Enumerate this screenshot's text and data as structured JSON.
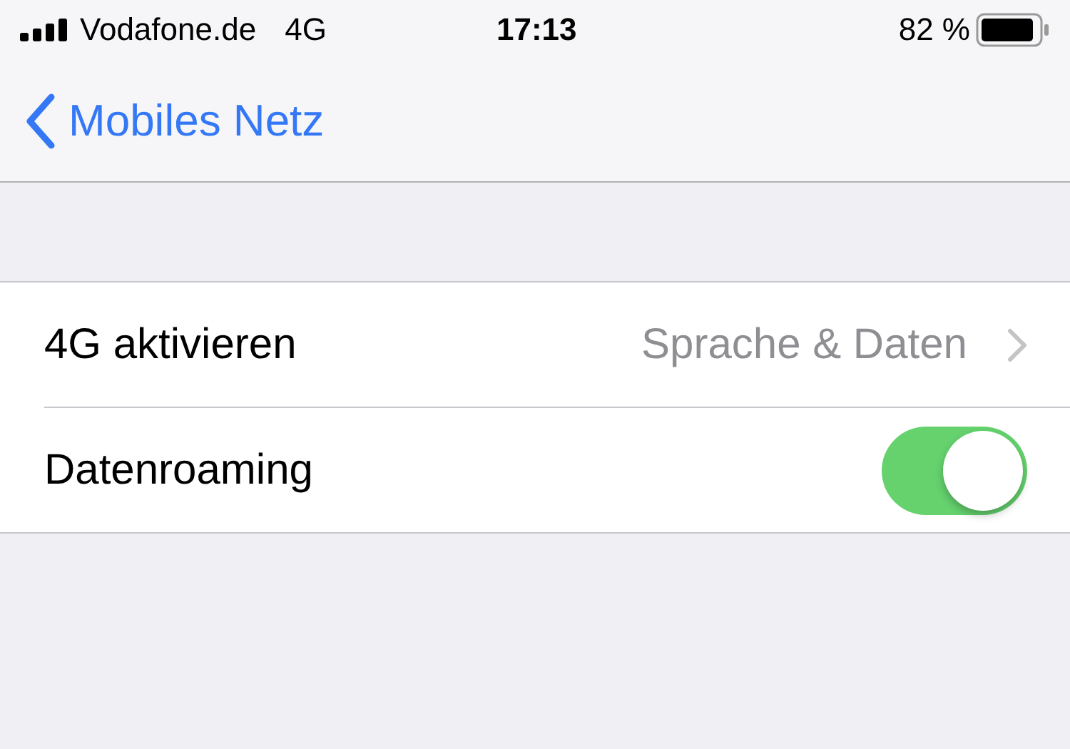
{
  "status_bar": {
    "carrier": "Vodafone.de",
    "network": "4G",
    "time": "17:13",
    "battery": "82 %"
  },
  "nav": {
    "back_label": "Mobiles Netz"
  },
  "rows": [
    {
      "kind": "disclosure",
      "label": "4G aktivieren",
      "value": "Sprache & Daten"
    },
    {
      "kind": "toggle",
      "label": "Datenroaming",
      "on": true
    }
  ]
}
